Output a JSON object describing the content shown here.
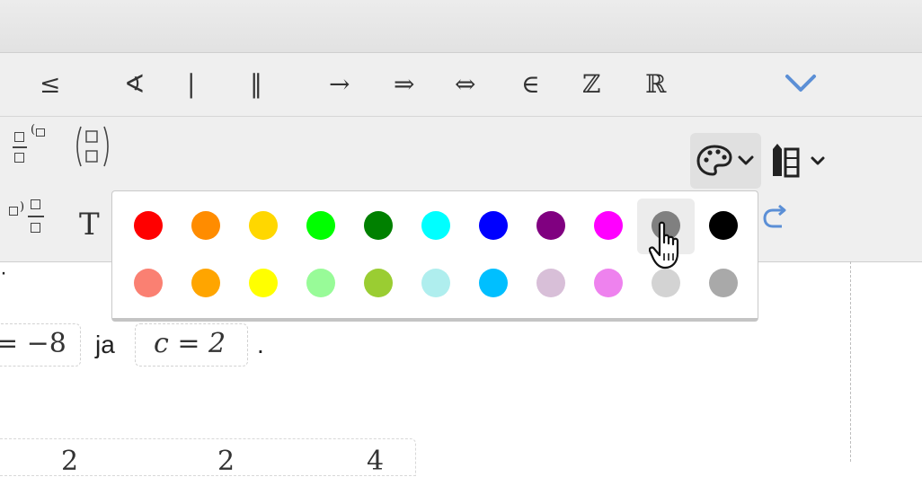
{
  "toolbar": {
    "relation_symbols": [
      {
        "name": "less-equal",
        "glyph": "≤"
      },
      {
        "name": "angle",
        "glyph": "∢"
      },
      {
        "name": "divides",
        "glyph": "|"
      },
      {
        "name": "parallel",
        "glyph": "‖"
      },
      {
        "name": "right-arrow",
        "glyph": "→"
      },
      {
        "name": "implies",
        "glyph": "⇒"
      },
      {
        "name": "iff",
        "glyph": "⇔"
      },
      {
        "name": "element-of",
        "glyph": "∈"
      },
      {
        "name": "integers",
        "glyph": "ℤ"
      },
      {
        "name": "reals",
        "glyph": "ℝ"
      }
    ],
    "expand_icon": "chevron-down-icon",
    "text_button": "T",
    "accent_color": "#5b8fd6"
  },
  "color_picker": {
    "row1": [
      "#ff0000",
      "#ff8c00",
      "#ffd700",
      "#00ff00",
      "#008000",
      "#00ffff",
      "#0000ff",
      "#800080",
      "#ff00ff",
      "#808080",
      "#000000"
    ],
    "row2": [
      "#fa8072",
      "#ffa500",
      "#ffff00",
      "#98fb98",
      "#9acd32",
      "#afeeee",
      "#00bfff",
      "#d8bfd8",
      "#ee82ee",
      "#d3d3d3",
      "#a9a9a9"
    ],
    "hovered": "#808080"
  },
  "content": {
    "box1": "= −8",
    "conjunction": "ja",
    "box2": "c = 2",
    "period": ".",
    "bullet": "·",
    "bottom_glyphs": [
      "2",
      "2",
      "4"
    ]
  }
}
